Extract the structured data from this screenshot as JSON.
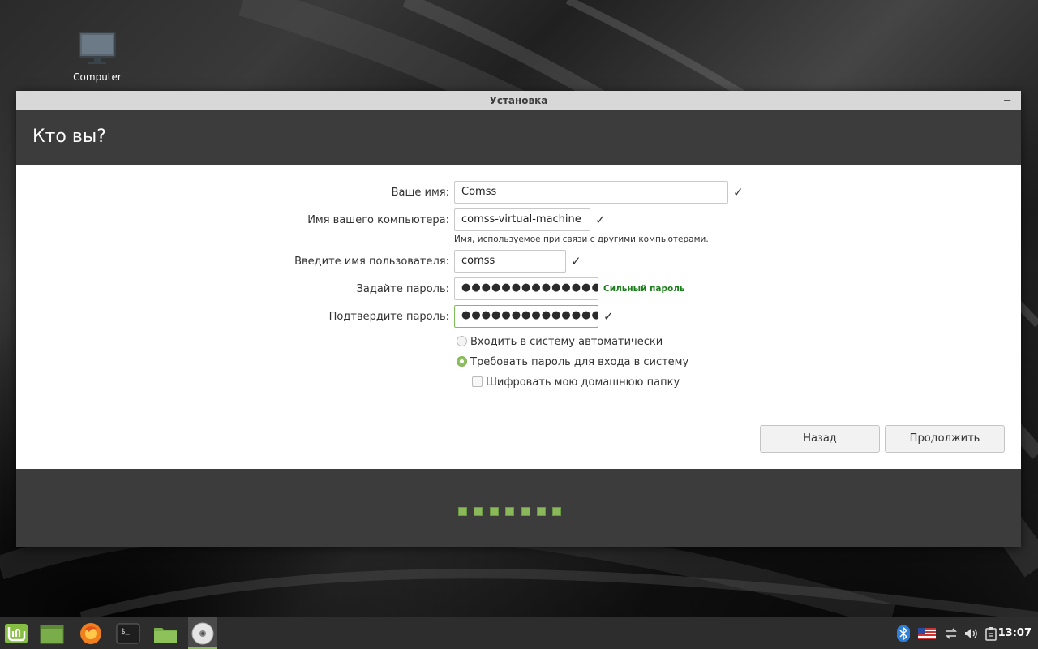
{
  "desktop": {
    "icons": [
      {
        "label": "Computer",
        "icon": "monitor-icon"
      }
    ]
  },
  "window": {
    "title": "Установка",
    "minimize_label": "‒",
    "header": "Кто вы?"
  },
  "form": {
    "name": {
      "label": "Ваше имя:",
      "value": "Comss"
    },
    "computer": {
      "label": "Имя вашего компьютера:",
      "value": "comss-virtual-machine",
      "hint": "Имя, используемое при связи с другими компьютерами."
    },
    "username": {
      "label": "Введите имя пользователя:",
      "value": "comss"
    },
    "password": {
      "label": "Задайте пароль:",
      "value": "●●●●●●●●●●●●●●",
      "strength": "Сильный пароль"
    },
    "confirm": {
      "label": "Подтвердите пароль:",
      "value": "●●●●●●●●●●●●●●"
    },
    "check_glyph": "✓"
  },
  "options": {
    "auto_login": {
      "label": "Входить в систему автоматически",
      "selected": false
    },
    "require_password": {
      "label": "Требовать пароль для входа в систему",
      "selected": true
    },
    "encrypt_home": {
      "label": "Шифровать мою домашнюю папку",
      "checked": false
    }
  },
  "buttons": {
    "back": "Назад",
    "continue": "Продолжить"
  },
  "progress": {
    "steps_total": 7,
    "steps_done": 7,
    "color": "#8ab85a"
  },
  "taskbar": {
    "items": [
      "mint-menu-icon",
      "show-desktop-icon",
      "firefox-icon",
      "terminal-icon",
      "files-icon",
      "installer-disc-icon"
    ],
    "tray": [
      "bluetooth-icon",
      "us-flag-icon",
      "network-icon",
      "volume-icon",
      "clipboard-icon"
    ],
    "clock": "13:07"
  },
  "colors": {
    "accent": "#8ab85a",
    "strong_password": "#1b7d1b",
    "header_bg": "#3c3c3c"
  }
}
